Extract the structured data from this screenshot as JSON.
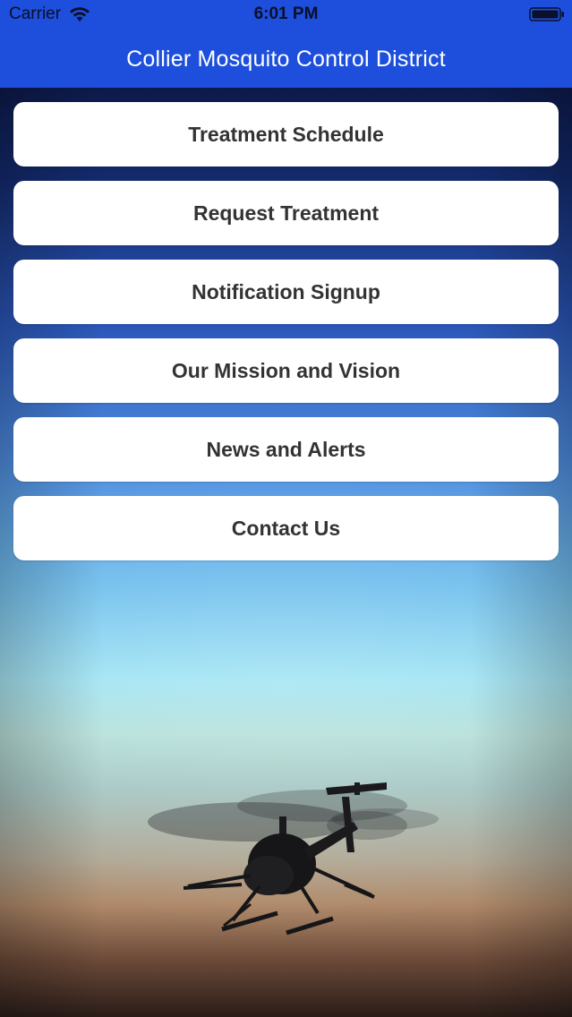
{
  "status_bar": {
    "carrier": "Carrier",
    "time": "6:01 PM",
    "icons": [
      "wifi-icon",
      "battery-icon"
    ]
  },
  "nav": {
    "title": "Collier Mosquito Control District",
    "bar_color": "#1d4fdc"
  },
  "menu": {
    "items": [
      {
        "label": "Treatment Schedule"
      },
      {
        "label": "Request Treatment"
      },
      {
        "label": "Notification Signup"
      },
      {
        "label": "Our Mission and Vision"
      },
      {
        "label": "News and Alerts"
      },
      {
        "label": "Contact Us"
      }
    ],
    "button_color": "#ffffff",
    "text_color": "#333333"
  },
  "background": {
    "image": "helicopter-silhouette-at-dusk"
  }
}
